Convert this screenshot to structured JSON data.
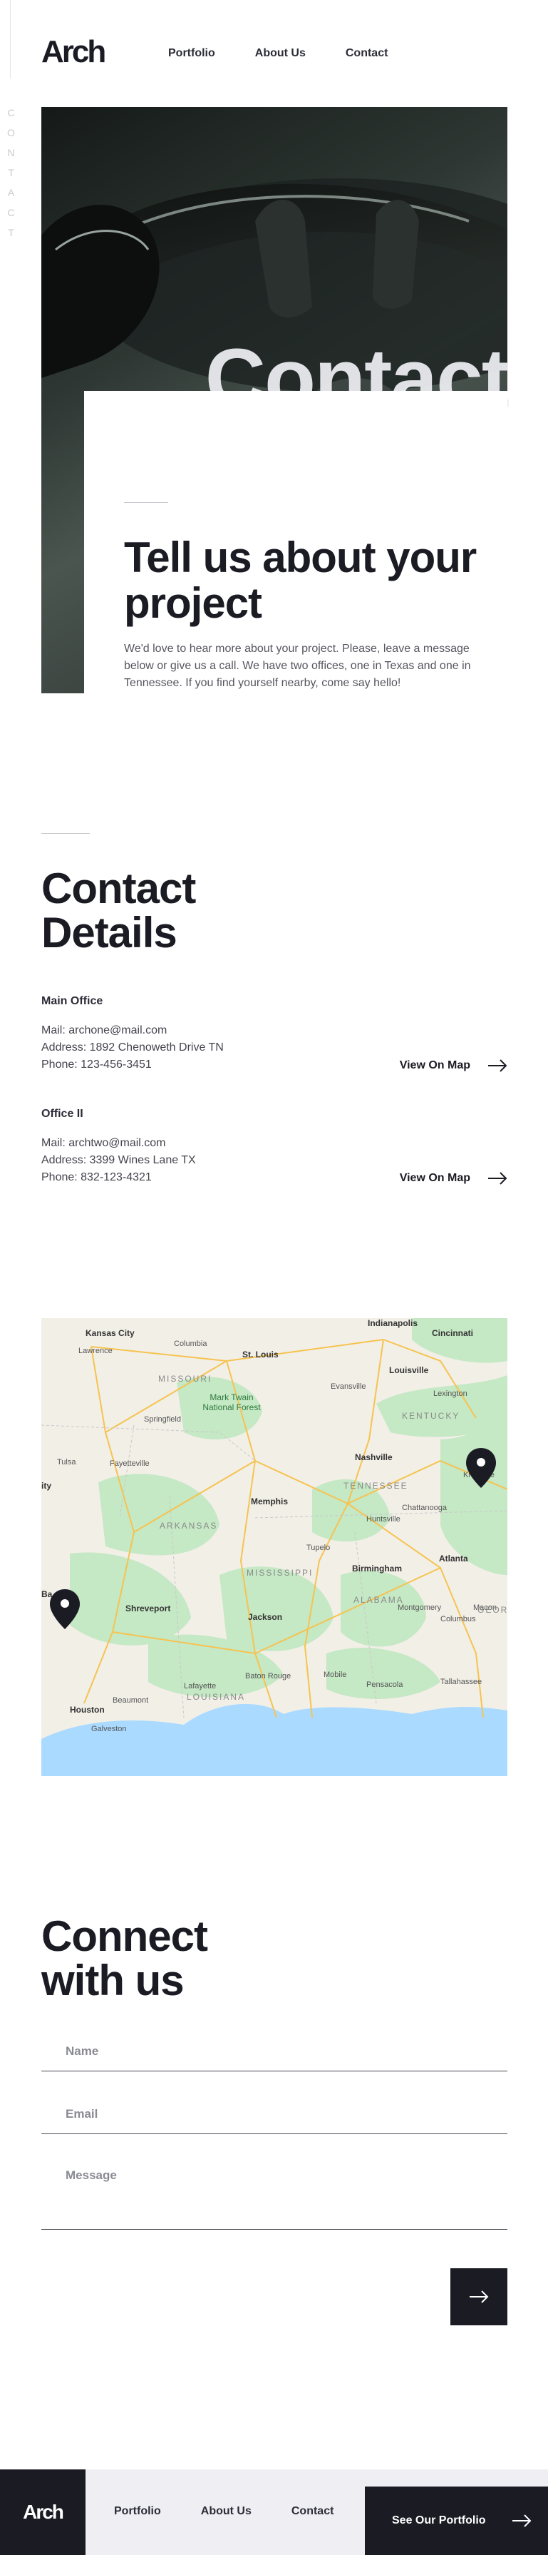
{
  "header": {
    "logo": "Arch",
    "nav": [
      "Portfolio",
      "About Us",
      "Contact"
    ],
    "side_label": [
      "C",
      "O",
      "N",
      "T",
      "A",
      "C",
      "T"
    ]
  },
  "hero": {
    "big_title": "Contact",
    "heading": "Tell us about your project",
    "intro": "We'd love to hear more about your project. Please, leave a message below or give us a call. We have two offices, one in Texas and one in Tennessee. If you find yourself nearby, come say hello!"
  },
  "details": {
    "heading": "Contact Details",
    "offices": [
      {
        "title": "Main Office",
        "mail": "Mail: archone@mail.com",
        "address": "Address: 1892 Chenoweth Drive TN",
        "phone": "Phone: 123-456-3451",
        "map_link": "View On Map"
      },
      {
        "title": "Office II",
        "mail": "Mail: archtwo@mail.com",
        "address": "Address: 3399 Wines Lane TX",
        "phone": "Phone: 832-123-4321",
        "map_link": "View On Map"
      }
    ]
  },
  "map": {
    "cities": [
      "Kansas City",
      "St. Louis",
      "Indianapolis",
      "Cincinnati",
      "Louisville",
      "Nashville",
      "Memphis",
      "Atlanta",
      "Birmingham",
      "Houston",
      "Shreveport",
      "Jackson"
    ],
    "towns": [
      "Columbia",
      "Lawrence",
      "Springfield",
      "Evansville",
      "Lexington",
      "Fayetteville",
      "Chattanooga",
      "Huntsville",
      "Knoxville",
      "Tupelo",
      "Montgomery",
      "Columbus",
      "Mobile",
      "Pensacola",
      "Tallahassee",
      "Lafayette",
      "Beaumont",
      "Galveston",
      "Baton Rouge",
      "Tulsa",
      "Macon"
    ],
    "states": [
      "MISSOURI",
      "KENTUCKY",
      "ARKANSAS",
      "TENNESSEE",
      "MISSISSIPPI",
      "ALABAMA",
      "LOUISIANA",
      "GEORG"
    ],
    "park": "Mark Twain National Forest",
    "edge_labels": [
      "ity",
      "Ba"
    ]
  },
  "connect": {
    "heading": "Connect with us",
    "name_placeholder": "Name",
    "email_placeholder": "Email",
    "message_placeholder": "Message"
  },
  "footer": {
    "logo": "Arch",
    "nav": [
      "Portfolio",
      "About Us",
      "Contact"
    ],
    "cta": "See Our Portfolio"
  },
  "colors": {
    "ink": "#1b1b24",
    "muted": "#55555f",
    "footer_bg": "#efeff3",
    "map_water": "#aadaff",
    "map_green": "#c5e8c5"
  }
}
